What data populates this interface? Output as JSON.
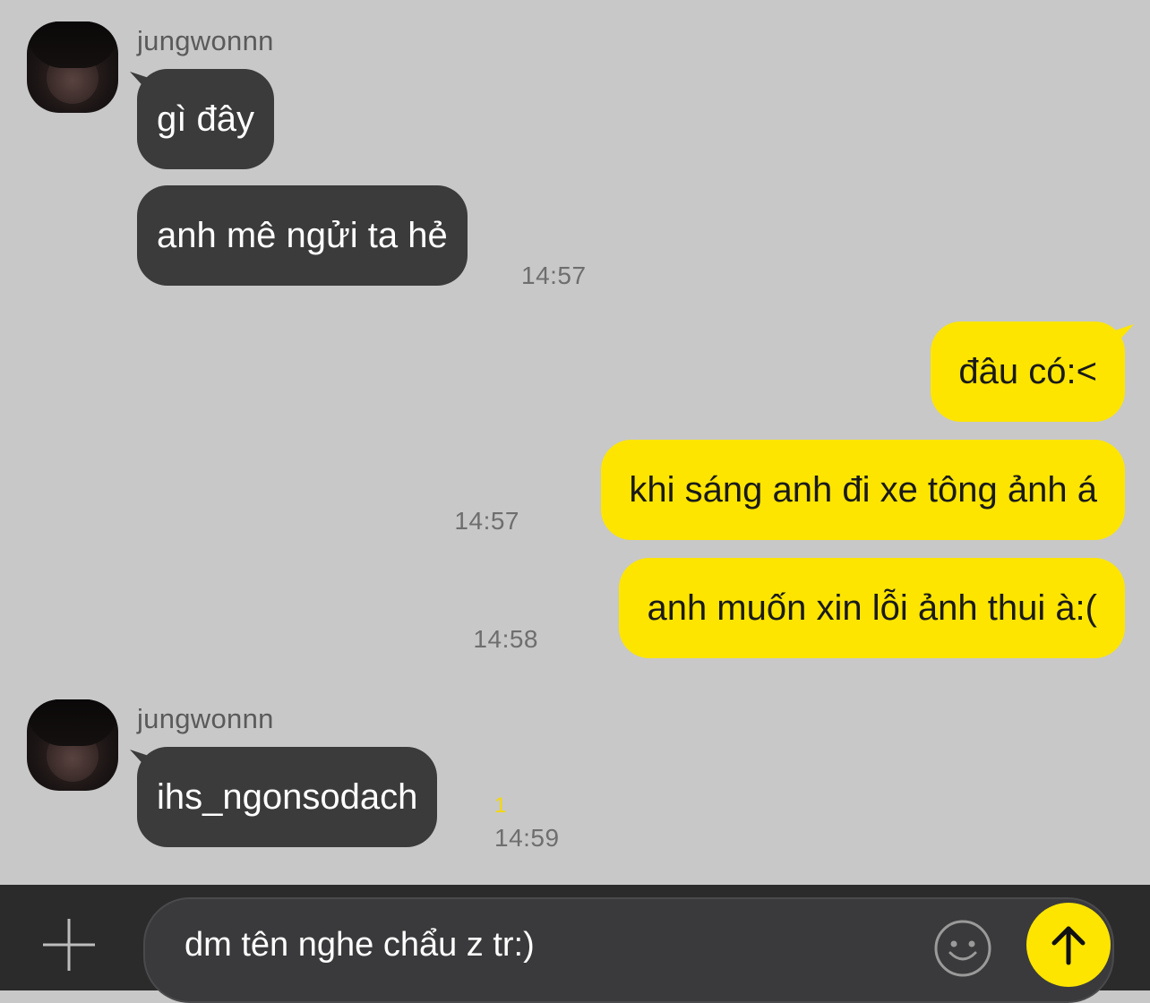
{
  "conversation": {
    "contact_name": "jungwonnn",
    "groups": [
      {
        "sender": "jungwonnn",
        "messages": [
          {
            "text": "gì đây"
          },
          {
            "text": "anh mê ngửi ta hẻ",
            "time": "14:57"
          }
        ]
      },
      {
        "sender": "me",
        "messages": [
          {
            "text": "đâu có:<"
          },
          {
            "text": "khi sáng anh đi xe tông ảnh á",
            "time": "14:57"
          },
          {
            "text": "anh muốn xin lỗi ảnh thui à:(",
            "time": "14:58"
          }
        ]
      },
      {
        "sender": "jungwonnn",
        "messages": [
          {
            "text": "ihs_ngonsodach",
            "unread": "1",
            "time": "14:59"
          }
        ]
      }
    ]
  },
  "composer": {
    "input_value": "dm tên nghe chẩu z tr:)",
    "plus_icon": "plus-icon",
    "emoji_icon": "smiley-icon",
    "send_icon": "arrow-up-icon"
  },
  "colors": {
    "background": "#c8c8c8",
    "incoming_bubble": "#3b3b3c",
    "outgoing_bubble": "#fde500",
    "input_bar": "#2b2b2c",
    "send_button": "#fde500"
  }
}
